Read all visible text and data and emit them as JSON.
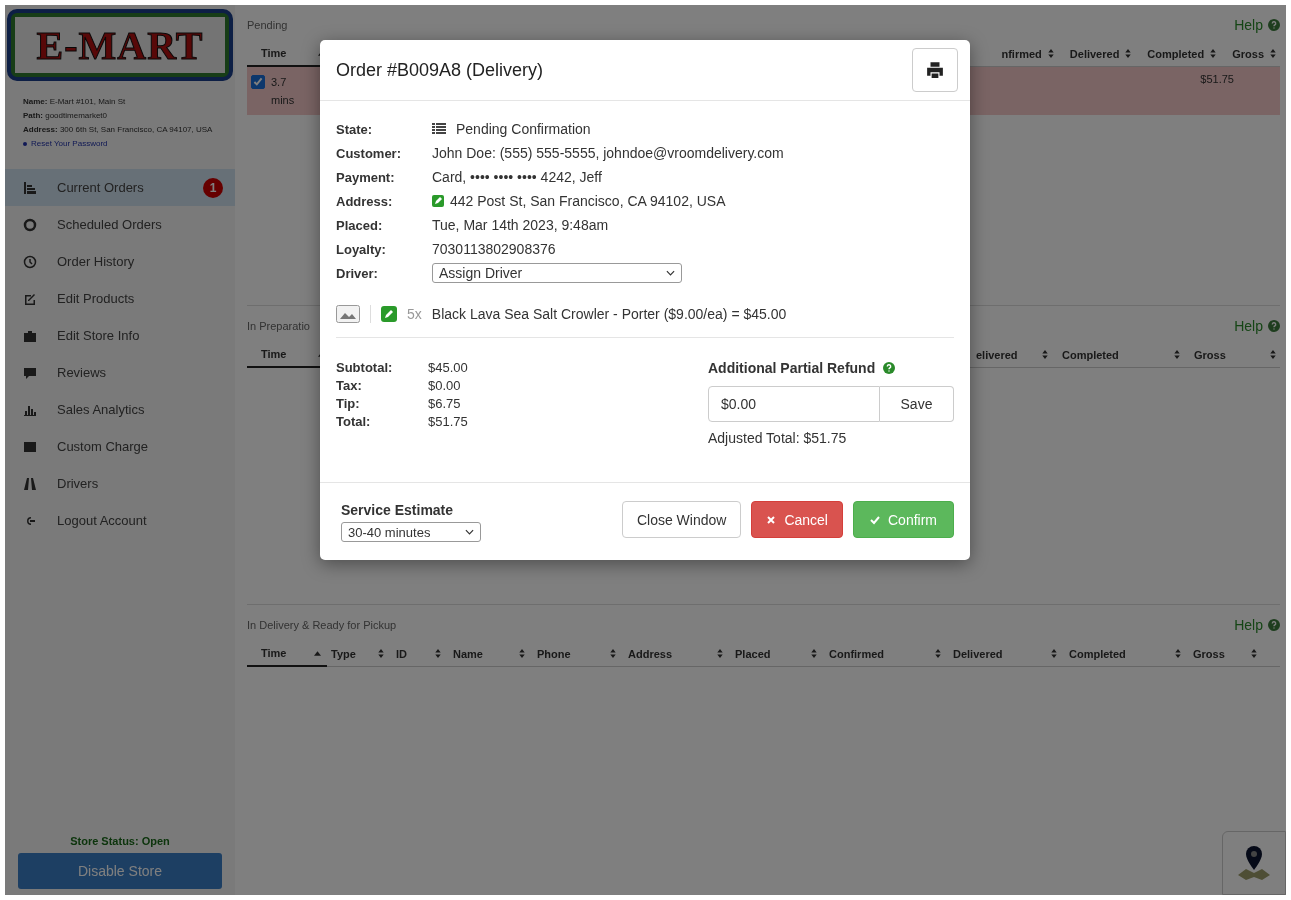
{
  "store": {
    "logo": "E-MART",
    "info": [
      "**Name:** E-Mart #101, Main St",
      "**Path:** goodtimemarket0",
      "**Address:** 300 6th St, San Francisco, CA 94107, USA"
    ],
    "reset_link": "Reset Your Password"
  },
  "nav": [
    {
      "label": "Current Orders",
      "selected": true,
      "badge": "1"
    },
    {
      "label": "Scheduled Orders",
      "selected": false
    },
    {
      "label": "Order History",
      "selected": false
    },
    {
      "label": "Edit Products",
      "selected": false
    },
    {
      "label": "Edit Store Info",
      "selected": false
    },
    {
      "label": "Reviews",
      "selected": false
    },
    {
      "label": "Sales Analytics",
      "selected": false
    },
    {
      "label": "Custom Charge",
      "selected": false
    },
    {
      "label": "Drivers",
      "selected": false
    },
    {
      "label": "Logout Account",
      "selected": false
    }
  ],
  "store_status": "Store Status: Open",
  "disable_button": "Disable Store",
  "sections": [
    {
      "kind": "pending",
      "title": "Pending",
      "help": "Help",
      "first_column": "Time",
      "columns": [
        "nfirmed",
        "Delivered",
        "Completed",
        "Gross"
      ],
      "rows": [
        {
          "checked": true,
          "time": "3.7 mins",
          "gross": "$51.75"
        }
      ]
    },
    {
      "kind": "prep",
      "title": "In Preparatio",
      "help": "Help",
      "first_column": "Time",
      "columns": [
        "elivered",
        "Completed",
        "Gross"
      ]
    },
    {
      "kind": "delivery",
      "title": "In Delivery & Ready for Pickup",
      "help": "Help",
      "first_column": "Time",
      "columns": [
        "Type",
        "ID",
        "Name",
        "Phone",
        "Address",
        "Placed",
        "Confirmed",
        "Delivered",
        "Completed",
        "Gross"
      ]
    }
  ],
  "modal": {
    "title": "Order #B009A8 (Delivery)",
    "details": [
      {
        "label": "State:",
        "value": "Pending Confirmation",
        "kind": "state"
      },
      {
        "label": "Customer:",
        "value": "John Doe: (555) 555-5555, johndoe@vroomdelivery.com",
        "kind": "text"
      },
      {
        "label": "Payment:",
        "value": "Card, •••• •••• •••• 4242, Jeff",
        "kind": "text"
      },
      {
        "label": "Address:",
        "value": "442 Post St, San Francisco, CA 94102, USA",
        "kind": "address"
      },
      {
        "label": "Placed:",
        "value": "Tue, Mar 14th 2023, 9:48am",
        "kind": "text"
      },
      {
        "label": "Loyalty:",
        "value": "7030113802908376",
        "kind": "text"
      },
      {
        "label": "Driver:",
        "value": "Assign Driver",
        "kind": "select"
      }
    ],
    "items": [
      {
        "qty": "5x",
        "text": "Black Lava Sea Salt Crowler - Porter ($9.00/ea) = $45.00"
      }
    ],
    "totals": [
      {
        "label": "Subtotal:",
        "value": "$45.00"
      },
      {
        "label": "Tax:",
        "value": "$0.00"
      },
      {
        "label": "Tip:",
        "value": "$6.75"
      },
      {
        "label": "Total:",
        "value": "$51.75"
      }
    ],
    "refund": {
      "title": "Additional Partial Refund",
      "value": "$0.00",
      "save": "Save",
      "adjusted": "Adjusted Total: $51.75"
    },
    "service": {
      "label": "Service Estimate",
      "value": "30-40 minutes"
    },
    "buttons": [
      {
        "label": "Close Window",
        "kind": "default"
      },
      {
        "label": "Cancel",
        "kind": "danger"
      },
      {
        "label": "Confirm",
        "kind": "success"
      }
    ]
  }
}
